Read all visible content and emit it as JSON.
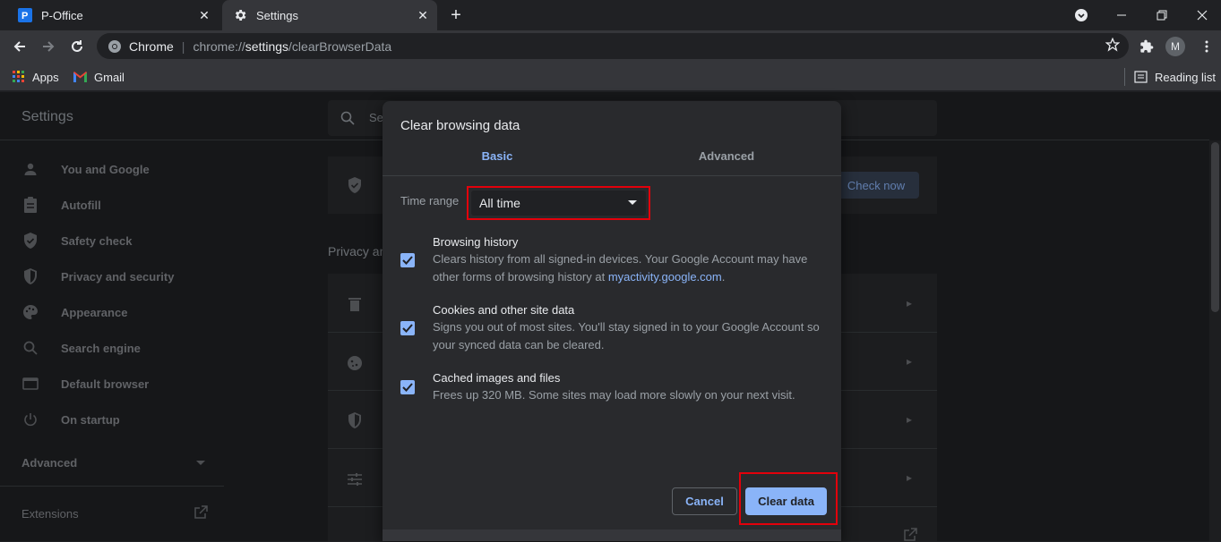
{
  "tabs": [
    {
      "title": "P-Office",
      "active": false,
      "icon": "p-office-icon"
    },
    {
      "title": "Settings",
      "active": true,
      "icon": "gear-icon"
    }
  ],
  "toolbar": {
    "site_label": "Chrome",
    "url_scheme": "chrome://",
    "url_host": "settings",
    "url_path": "/clearBrowserData",
    "avatar_initial": "M"
  },
  "bookmarks": {
    "apps": "Apps",
    "gmail": "Gmail",
    "reading_list": "Reading list"
  },
  "settings": {
    "title": "Settings",
    "search_placeholder": "Search settings",
    "nav": [
      {
        "label": "You and Google",
        "icon": "person-icon"
      },
      {
        "label": "Autofill",
        "icon": "clipboard-icon"
      },
      {
        "label": "Safety check",
        "icon": "shield-check-icon"
      },
      {
        "label": "Privacy and security",
        "icon": "shield-icon"
      },
      {
        "label": "Appearance",
        "icon": "palette-icon"
      },
      {
        "label": "Search engine",
        "icon": "search-icon"
      },
      {
        "label": "Default browser",
        "icon": "browser-icon"
      },
      {
        "label": "On startup",
        "icon": "power-icon"
      }
    ],
    "advanced": "Advanced",
    "extensions": "Extensions",
    "check_now": "Check now",
    "privacy_heading": "Privacy and security"
  },
  "dialog": {
    "title": "Clear browsing data",
    "tab_basic": "Basic",
    "tab_advanced": "Advanced",
    "time_range_label": "Time range",
    "time_range_value": "All time",
    "options": [
      {
        "title": "Browsing history",
        "desc_before_link": "Clears history from all signed-in devices. Your Google Account may have other forms of browsing history at ",
        "link": "myactivity.google.com",
        "desc_after_link": ".",
        "checked": true
      },
      {
        "title": "Cookies and other site data",
        "desc": "Signs you out of most sites. You'll stay signed in to your Google Account so your synced data can be cleared.",
        "checked": true
      },
      {
        "title": "Cached images and files",
        "desc": "Frees up 320 MB. Some sites may load more slowly on your next visit.",
        "checked": true
      }
    ],
    "cancel": "Cancel",
    "clear": "Clear data"
  },
  "colors": {
    "accent": "#8ab4f8",
    "highlight": "#e3000b",
    "background": "#202124",
    "surface": "#292a2d"
  }
}
